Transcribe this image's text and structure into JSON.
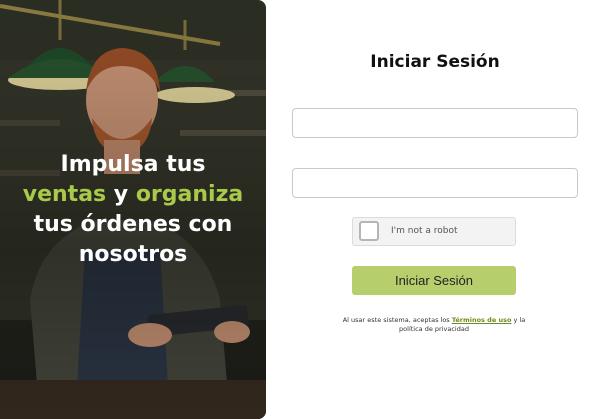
{
  "hero": {
    "line1": "Impulsa tus",
    "line2_accent1": "ventas",
    "line2_mid": " y ",
    "line2_accent2": "organiza",
    "line3": "tus órdenes con",
    "line4": "nosotros",
    "accent_color": "#a9c94a"
  },
  "login": {
    "title": "Iniciar Sesión",
    "username_value": "",
    "password_value": "",
    "captcha_label": "I'm not a robot",
    "submit_label": "Iniciar Sesión",
    "button_color": "#b6cf6c",
    "legal_prefix": "Al usar este sistema, aceptas los ",
    "legal_link": "Términos de uso",
    "legal_suffix": " y la política de privacidad"
  }
}
